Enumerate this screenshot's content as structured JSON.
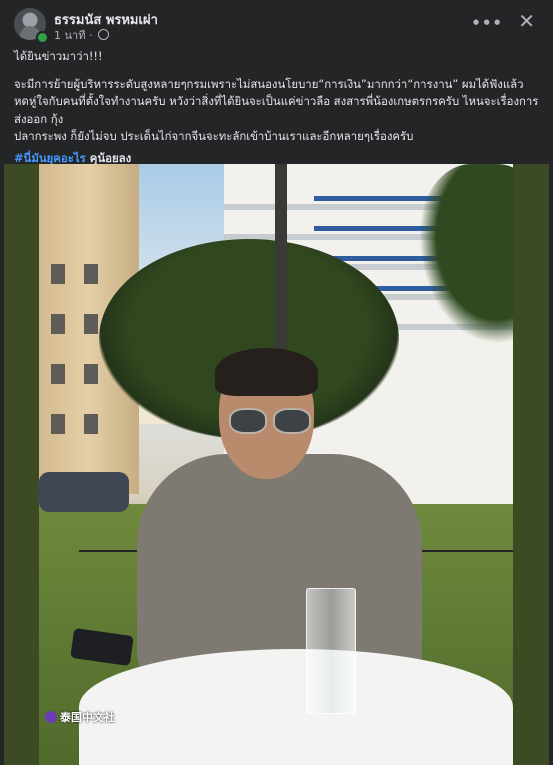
{
  "post": {
    "author": "ธรรมนัส พรหมเผ่า",
    "time": "1 นาที",
    "separator": "·",
    "privacy_icon": "globe-icon",
    "more_label": "•••",
    "close_label": "✕",
    "caption": {
      "line1": "ได้ยินข่าวมาว่า!!!",
      "line2": "จะมีการย้ายผู้บริหารระดับสูงหลายๆกรมเพราะไม่สนองนโยบาย“การเงิน”มากกว่า“การงาน” ผมได้ฟังแล้วหดหู่ใจกับคนที่ตั้งใจทำงานครับ หวังว่าสิ่งที่ได้ยินจะเป็นแค่ข่าวลือ  สงสารพี่น้องเกษตรกรครับ ไหนจะเรื่องการส่งออก กุ้ง",
      "line3": "ปลากระพง ก็ยังไม่จบ ประเด็นไก่จากจีนจะทะลักเข้าบ้านเราและอีกหลายๆเรื่องครับ",
      "hashtag": "#นี่มันยุคอะไร",
      "hashtag_suffix": " คุน้อยลง"
    },
    "photo": {
      "watermark": "泰国中文社"
    }
  },
  "colors": {
    "background": "#242526",
    "text": "#e4e6eb",
    "secondary_text": "#b0b3b8",
    "hashtag": "#4599ff",
    "online": "#31a24c"
  }
}
